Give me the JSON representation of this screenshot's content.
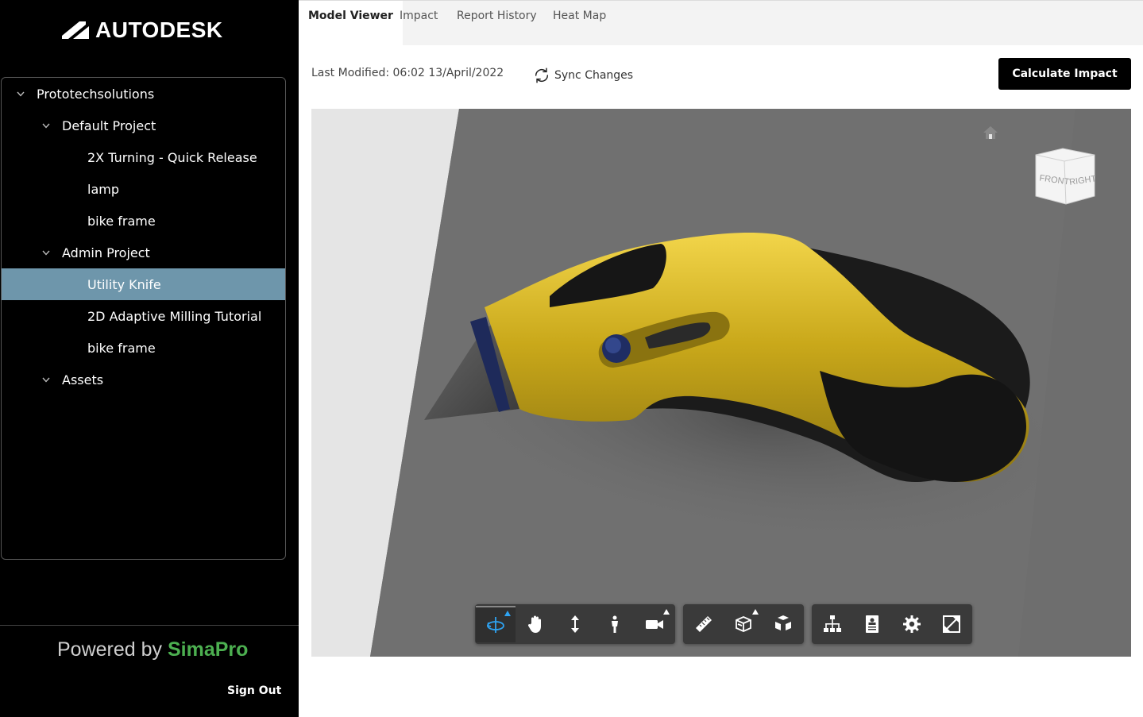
{
  "brand": {
    "name": "AUTODESK"
  },
  "tree": {
    "items": [
      {
        "label": "Prototechsolutions",
        "level": 0,
        "expanded": true
      },
      {
        "label": "Default Project",
        "level": 1,
        "expanded": true
      },
      {
        "label": "2X Turning - Quick Release",
        "level": 2
      },
      {
        "label": "lamp",
        "level": 2
      },
      {
        "label": "bike frame",
        "level": 2
      },
      {
        "label": "Admin Project",
        "level": 1,
        "expanded": true
      },
      {
        "label": "Utility Knife",
        "level": 2,
        "selected": true
      },
      {
        "label": "2D Adaptive Milling Tutorial",
        "level": 2
      },
      {
        "label": "bike frame",
        "level": 2
      },
      {
        "label": "Assets",
        "level": 1,
        "expanded": true
      }
    ]
  },
  "footer": {
    "powered_by": "Powered by",
    "powered_brand": "SimaPro",
    "sign_out": "Sign Out"
  },
  "tabs": [
    {
      "label": "Model Viewer",
      "active": true
    },
    {
      "label": "Impact"
    },
    {
      "label": "Report History"
    },
    {
      "label": "Heat Map"
    }
  ],
  "header": {
    "last_modified": "Last Modified: 06:02 13/April/2022",
    "sync_label": "Sync Changes",
    "calculate_label": "Calculate Impact"
  },
  "viewer": {
    "viewcube": {
      "front": "FRONT",
      "right": "RIGHT"
    },
    "toolbar_groups": [
      [
        {
          "icon": "orbit-icon",
          "active": true,
          "flyout": true
        },
        {
          "icon": "pan-hand-icon"
        },
        {
          "icon": "dolly-zoom-icon"
        },
        {
          "icon": "first-person-icon"
        },
        {
          "icon": "camera-icon",
          "flyout": true
        }
      ],
      [
        {
          "icon": "measure-ruler-icon"
        },
        {
          "icon": "section-box-icon",
          "flyout": true
        },
        {
          "icon": "explode-icon"
        }
      ],
      [
        {
          "icon": "model-browser-icon"
        },
        {
          "icon": "properties-icon"
        },
        {
          "icon": "settings-gear-icon"
        },
        {
          "icon": "fullscreen-icon"
        }
      ]
    ]
  },
  "colors": {
    "sidebar_bg": "#000000",
    "selected_bg": "#6e96ab",
    "accent_blue": "#2ea3f2",
    "simapro_green": "#4caf50",
    "knife_yellow": "#c9a81a"
  }
}
